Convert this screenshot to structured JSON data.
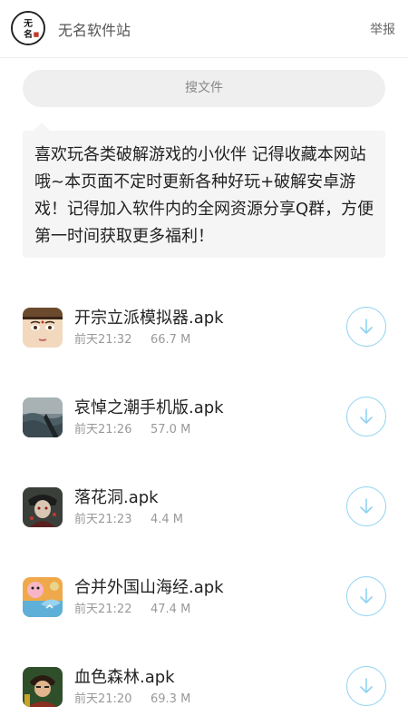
{
  "header": {
    "site_title": "无名软件站",
    "report_label": "举报",
    "logo_text": "无名"
  },
  "search": {
    "label": "搜文件"
  },
  "notice": {
    "text": "喜欢玩各类破解游戏的小伙伴 记得收藏本网站哦~本页面不定时更新各种好玩+破解安卓游戏！记得加入软件内的全网资源分享Q群，方便第一时间获取更多福利！"
  },
  "apps": [
    {
      "name": "开宗立派模拟器.apk",
      "time": "前天21:32",
      "size": "66.7 M",
      "icon": "face-app-icon"
    },
    {
      "name": "哀悼之潮手机版.apk",
      "time": "前天21:26",
      "size": "57.0 M",
      "icon": "ocean-app-icon"
    },
    {
      "name": "落花洞.apk",
      "time": "前天21:23",
      "size": "4.4 M",
      "icon": "dark-character-app-icon"
    },
    {
      "name": "合并外国山海经.apk",
      "time": "前天21:22",
      "size": "47.4 M",
      "icon": "creatures-app-icon"
    },
    {
      "name": "血色森林.apk",
      "time": "前天21:20",
      "size": "69.3 M",
      "icon": "warrior-app-icon"
    }
  ],
  "colors": {
    "accent": "#8fd3f0",
    "muted_text": "#999999",
    "notice_bg": "#f5f5f5",
    "search_bg": "#efefef"
  }
}
